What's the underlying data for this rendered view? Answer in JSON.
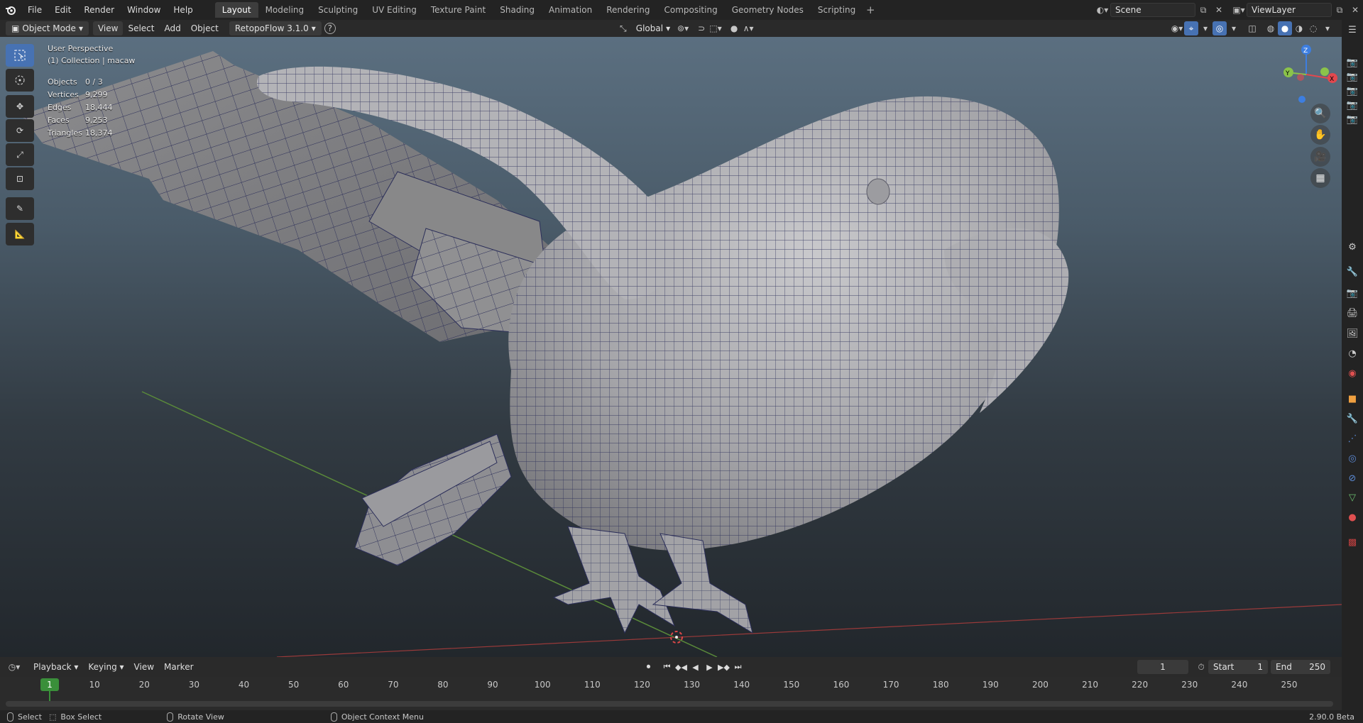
{
  "topbar": {
    "menus": [
      "File",
      "Edit",
      "Render",
      "Window",
      "Help"
    ],
    "workspaces": [
      "Layout",
      "Modeling",
      "Sculpting",
      "UV Editing",
      "Texture Paint",
      "Shading",
      "Animation",
      "Rendering",
      "Compositing",
      "Geometry Nodes",
      "Scripting"
    ],
    "active_workspace": "Layout",
    "scene": "Scene",
    "view_layer": "ViewLayer"
  },
  "viewport_header": {
    "mode": "Object Mode",
    "menus": [
      "View",
      "Select",
      "Add",
      "Object"
    ],
    "addon": "RetopoFlow 3.1.0",
    "help": "?",
    "orientation": "Global"
  },
  "overlay": {
    "perspective": "User Perspective",
    "collection": "(1) Collection | macaw",
    "stats": [
      {
        "label": "Objects",
        "value": "0 / 3"
      },
      {
        "label": "Vertices",
        "value": "9,299"
      },
      {
        "label": "Edges",
        "value": "18,444"
      },
      {
        "label": "Faces",
        "value": "9,253"
      },
      {
        "label": "Triangles",
        "value": "18,374"
      }
    ]
  },
  "gizmo": {
    "z": "Z",
    "y": "Y",
    "x": "X"
  },
  "timeline": {
    "menus": [
      "Playback",
      "Keying",
      "View",
      "Marker"
    ],
    "current_frame": "1",
    "start_label": "Start",
    "start": "1",
    "end_label": "End",
    "end": "250",
    "ticks": [
      "1",
      "10",
      "20",
      "30",
      "40",
      "50",
      "60",
      "70",
      "80",
      "90",
      "100",
      "110",
      "120",
      "130",
      "140",
      "150",
      "160",
      "170",
      "180",
      "190",
      "200",
      "210",
      "220",
      "230",
      "240",
      "250"
    ]
  },
  "status": {
    "select": "Select",
    "box_select": "Box Select",
    "rotate_view": "Rotate View",
    "context_menu": "Object Context Menu",
    "version": "2.90.0 Beta"
  },
  "colors": {
    "accent": "#4772b3",
    "current_frame": "#3a8f3a",
    "axis_x": "#e2484e",
    "axis_y": "#8bc34a",
    "axis_z": "#3d7ee0"
  },
  "icons": [
    "blender-logo",
    "select-box-icon",
    "cursor-icon",
    "move-icon",
    "rotate-icon",
    "scale-icon",
    "transform-icon",
    "annotate-icon",
    "measure-icon",
    "zoom-icon",
    "hand-icon",
    "camera-icon",
    "grid-icon"
  ]
}
